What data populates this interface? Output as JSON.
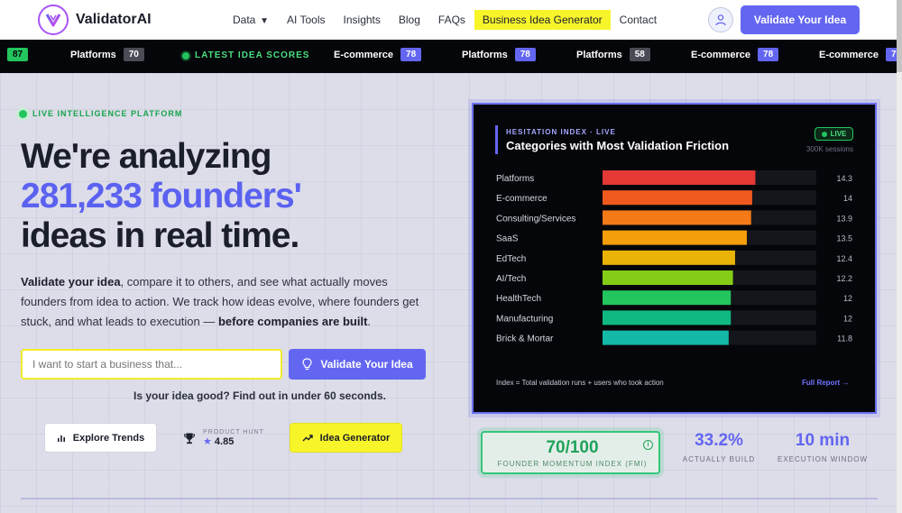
{
  "brand": {
    "name": "ValidatorAI",
    "logo_letter": "V"
  },
  "nav": {
    "links": [
      {
        "label": "Data",
        "has_caret": true
      },
      {
        "label": "AI Tools"
      },
      {
        "label": "Insights"
      },
      {
        "label": "Blog"
      },
      {
        "label": "FAQs"
      },
      {
        "label": "Business Idea Generator",
        "highlighted": true
      },
      {
        "label": "Contact"
      }
    ],
    "cta": "Validate Your Idea"
  },
  "ticker": {
    "live_label": "LATEST IDEA SCORES",
    "items": [
      {
        "label": "",
        "score": "87",
        "style": "green"
      },
      {
        "label": "Platforms",
        "score": "70",
        "style": "gray"
      },
      {
        "label": "E-commerce",
        "score": "78",
        "style": "purple"
      },
      {
        "label": "Platforms",
        "score": "78",
        "style": "purple"
      },
      {
        "label": "Platforms",
        "score": "58",
        "style": "gray"
      },
      {
        "label": "E-commerce",
        "score": "78",
        "style": "purple"
      },
      {
        "label": "E-commerce",
        "score": "7",
        "style": "purple"
      }
    ]
  },
  "hero": {
    "badge": "LIVE INTELLIGENCE PLATFORM",
    "headline_line1": "We're analyzing",
    "headline_accent": "281,233 founders'",
    "headline_line3": "ideas in real time.",
    "desc_bold1": "Validate your idea",
    "desc_text1": ", compare it to others, and see what actually moves founders from idea to action. We track how ideas evolve, where founders get stuck, and what leads to execution — ",
    "desc_bold2": "before companies are built",
    "desc_text2": ".",
    "input_placeholder": "I want to start a business that...",
    "validate_button": "Validate Your Idea",
    "subquestion": "Is your idea good? Find out in under 60 seconds.",
    "explore_button": "Explore Trends",
    "product_hunt_caption": "PRODUCT HUNT",
    "product_hunt_rating": "4.85",
    "generator_button": "Idea Generator"
  },
  "card": {
    "kicker": "HESITATION INDEX · LIVE",
    "title": "Categories with Most Validation Friction",
    "live_pill": "LIVE",
    "sessions": "300K sessions",
    "footer": "Index = Total validation runs + users who took action",
    "full_report": "Full Report →"
  },
  "chart_data": {
    "type": "bar",
    "orientation": "horizontal",
    "categories": [
      "Platforms",
      "E-commerce",
      "Consulting/Services",
      "SaaS",
      "EdTech",
      "AI/Tech",
      "HealthTech",
      "Manufacturing",
      "Brick & Mortar"
    ],
    "values": [
      14.3,
      14,
      13.9,
      13.5,
      12.4,
      12.2,
      12,
      12,
      11.8
    ],
    "value_labels": [
      "14.3",
      "14",
      "13.9",
      "13.5",
      "12.4",
      "12.2",
      "12",
      "12",
      "11.8"
    ],
    "colors": [
      "#e53935",
      "#ef5a1f",
      "#f47a18",
      "#f59e0b",
      "#eab308",
      "#84cc16",
      "#22c55e",
      "#10b981",
      "#14b8a6"
    ],
    "track_color": "#15161c",
    "xlim": [
      0,
      20
    ],
    "grid": false
  },
  "metrics": {
    "fmi_value": "70/100",
    "fmi_label": "FOUNDER MOMENTUM INDEX (FMI)",
    "built_value": "33.2%",
    "built_label": "ACTUALLY BUILD",
    "window_value": "10 min",
    "window_label": "EXECUTION WINDOW"
  }
}
